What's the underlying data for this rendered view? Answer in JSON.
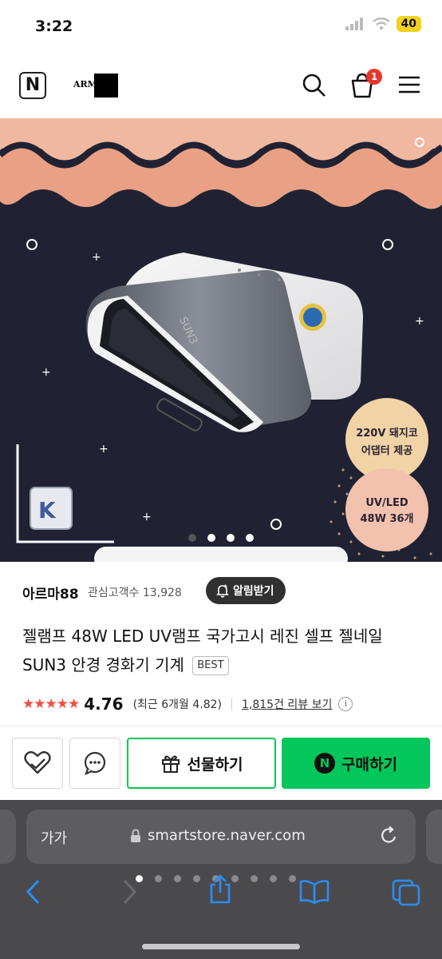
{
  "status_bar": {
    "time": "3:22",
    "battery": "40"
  },
  "header": {
    "brand_logo_text": "ARMA",
    "cart_badge": "1",
    "n_logo": "N"
  },
  "hero": {
    "badge_top": [
      "220V 돼지코",
      "어댑터 제공"
    ],
    "badge_bottom": [
      "UV/LED",
      "48W 36개"
    ],
    "device_label": "SUN3",
    "carousel_total": 4,
    "carousel_active": 1
  },
  "seller": {
    "name": "아르마88",
    "followers_label": "관심고객수 13,928",
    "alarm_label": "알림받기"
  },
  "product": {
    "title": "젤램프 48W LED UV램프 국가고시 레진 셀프 젤네일 SUN3 안경 경화기 기계",
    "badge": "BEST"
  },
  "rating": {
    "stars": "★★★★★",
    "score": "4.76",
    "recent": "(최근 6개월 4.82)",
    "reviews": "1,815건 리뷰 보기",
    "info": "i"
  },
  "actions": {
    "gift_label": "선물하기",
    "buy_label": "구매하기",
    "buy_n": "N"
  },
  "browser": {
    "aa_label": "가가",
    "url": "smartstore.naver.com",
    "tab_count": 9,
    "active_tab": 0
  },
  "colors": {
    "naver_green": "#03c75a",
    "salmon": "#e9a084",
    "hero_bg": "#202233",
    "rating_red": "#f14d45"
  }
}
